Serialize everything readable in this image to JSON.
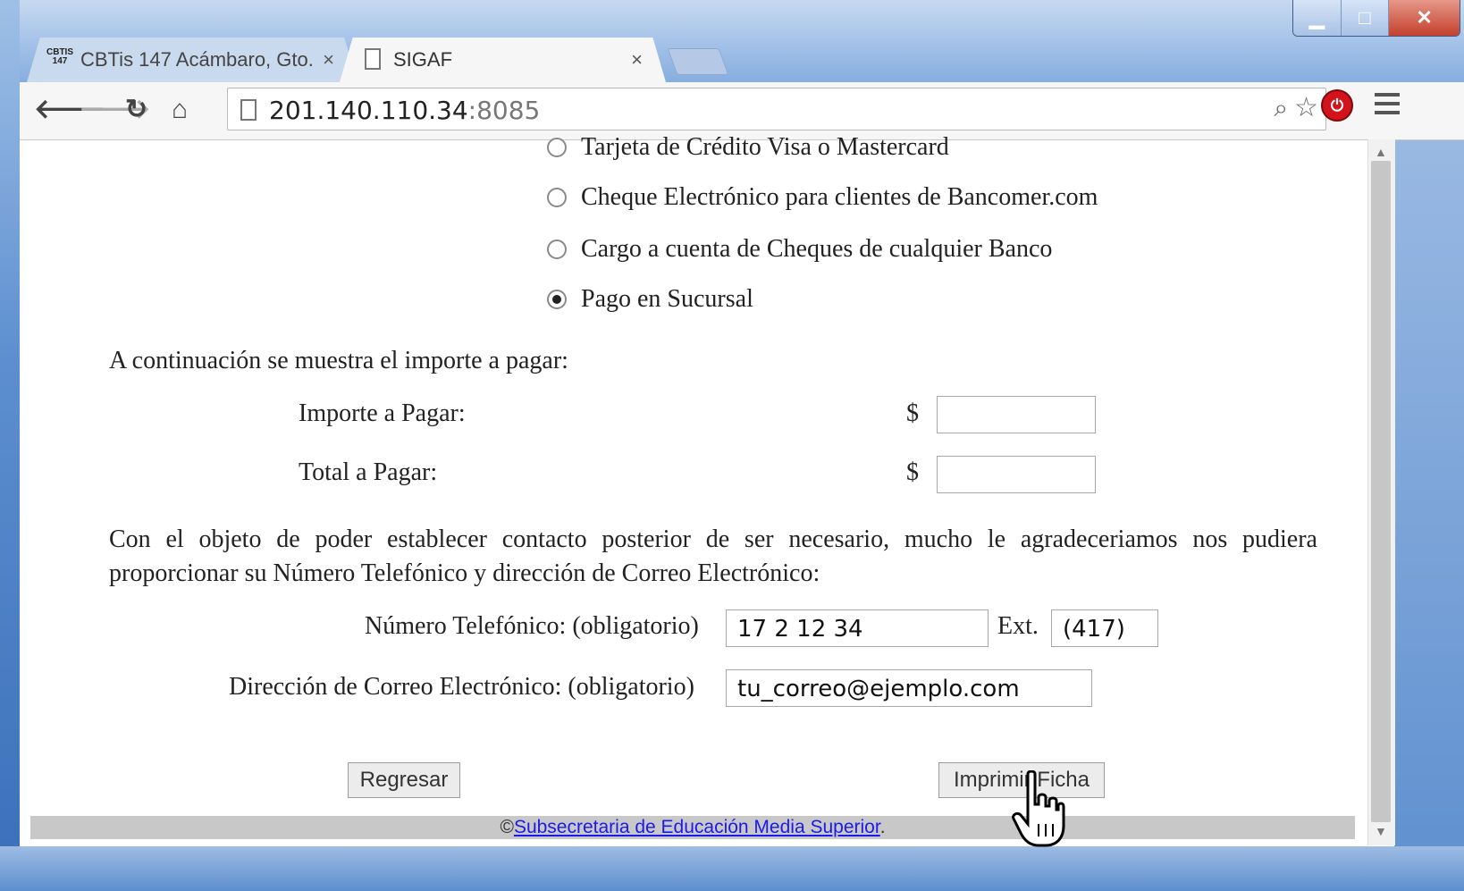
{
  "browser": {
    "tabs": [
      {
        "label": "CBTis 147 Acámbaro, Gto.",
        "favicon_text": "CBTIS 147",
        "close": "×"
      },
      {
        "label": "SIGAF",
        "close": "×"
      }
    ],
    "window_controls": {
      "minimize": "▁",
      "maximize": "□",
      "close": "✕"
    },
    "address": {
      "host": "201.140.110.34",
      "port": ":8085"
    },
    "icons": [
      "back-icon",
      "forward-icon",
      "reload-icon",
      "home-icon",
      "page-icon",
      "zoom-icon",
      "star-icon",
      "stop-extension-icon",
      "menu-icon"
    ]
  },
  "form": {
    "payment_options": [
      {
        "label": "Tarjeta de Crédito Visa o Mastercard",
        "checked": false
      },
      {
        "label": "Cheque Electrónico para clientes de Bancomer.com",
        "checked": false
      },
      {
        "label": "Cargo a cuenta de Cheques de cualquier Banco",
        "checked": false
      },
      {
        "label": "Pago en Sucursal",
        "checked": true
      }
    ],
    "amount_intro": "A continuación se muestra el importe a pagar:",
    "importe_label": "Importe a Pagar:",
    "total_label": "Total a Pagar:",
    "currency_symbol": "$",
    "importe_value": "",
    "total_value": "",
    "contact_intro": "Con el objeto de poder establecer contacto posterior de ser necesario, mucho le agradeceriamos nos pudiera proporcionar su Número Telefónico y dirección de Correo Electrónico:",
    "phone_label": "Número Telefónico: (obligatorio)",
    "phone_value": "17 2 12 34",
    "ext_label": "Ext.",
    "ext_value": "(417)",
    "email_label": "Dirección de Correo Electrónico: (obligatorio)",
    "email_value": "tu_correo@ejemplo.com",
    "back_button": "Regresar",
    "print_button": "Imprimir Ficha"
  },
  "footer": {
    "copyright": "©",
    "link": "Subsecretaria de Educación Media Superior",
    "suffix": "."
  }
}
